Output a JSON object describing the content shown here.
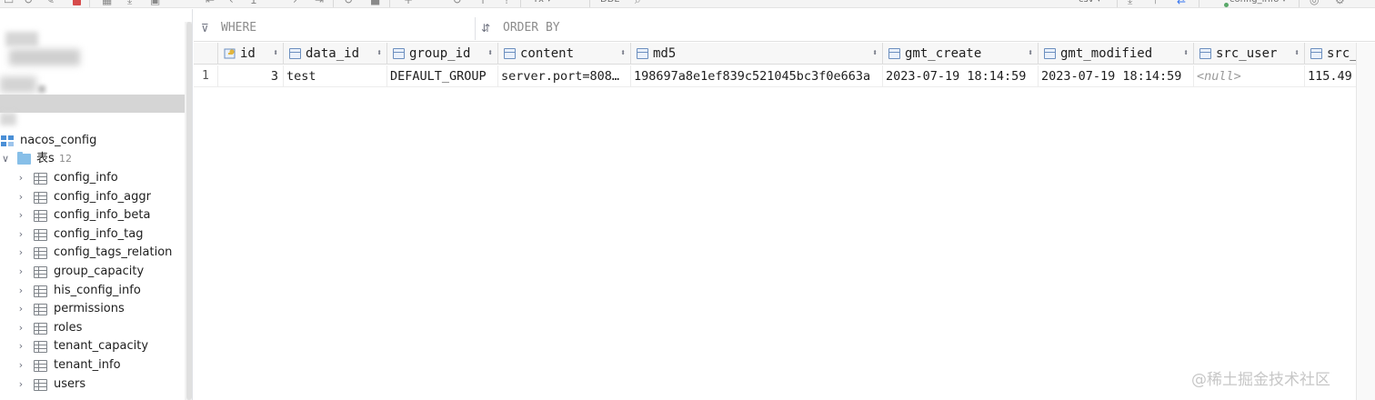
{
  "toolbar": {
    "format_label": "csv",
    "table_selector": "config_info"
  },
  "filter": {
    "where_placeholder": "WHERE",
    "orderby_placeholder": "ORDER BY"
  },
  "sidebar": {
    "schema": {
      "label": "nacos_config"
    },
    "tables_folder": {
      "label": "表s",
      "count": "12"
    },
    "tables": [
      {
        "label": "config_info"
      },
      {
        "label": "config_info_aggr"
      },
      {
        "label": "config_info_beta"
      },
      {
        "label": "config_info_tag"
      },
      {
        "label": "config_tags_relation"
      },
      {
        "label": "group_capacity"
      },
      {
        "label": "his_config_info"
      },
      {
        "label": "permissions"
      },
      {
        "label": "roles"
      },
      {
        "label": "tenant_capacity"
      },
      {
        "label": "tenant_info"
      },
      {
        "label": "users"
      }
    ]
  },
  "grid": {
    "columns": [
      {
        "label": "id",
        "icon": "primary-key-icon"
      },
      {
        "label": "data_id",
        "icon": "column-icon"
      },
      {
        "label": "group_id",
        "icon": "column-icon"
      },
      {
        "label": "content",
        "icon": "column-icon"
      },
      {
        "label": "md5",
        "icon": "column-icon"
      },
      {
        "label": "gmt_create",
        "icon": "column-icon"
      },
      {
        "label": "gmt_modified",
        "icon": "column-icon"
      },
      {
        "label": "src_user",
        "icon": "column-icon"
      },
      {
        "label": "src_",
        "icon": "column-icon"
      }
    ],
    "rows": [
      {
        "row_number": "1",
        "id": "3",
        "data_id": "test",
        "group_id": "DEFAULT_GROUP",
        "content": "server.port=808…",
        "md5": "198697a8e1ef839c521045bc3f0e663a",
        "gmt_create": "2023-07-19 18:14:59",
        "gmt_modified": "2023-07-19 18:14:59",
        "src_user": "<null>",
        "src_ip": "115.49"
      }
    ]
  },
  "watermark": "@稀土掘金技术社区",
  "colors": {
    "accent": "#3574f0",
    "selection": "#d5d5d5",
    "header_bg": "#f7f7f7",
    "folder": "#87bfe8"
  }
}
